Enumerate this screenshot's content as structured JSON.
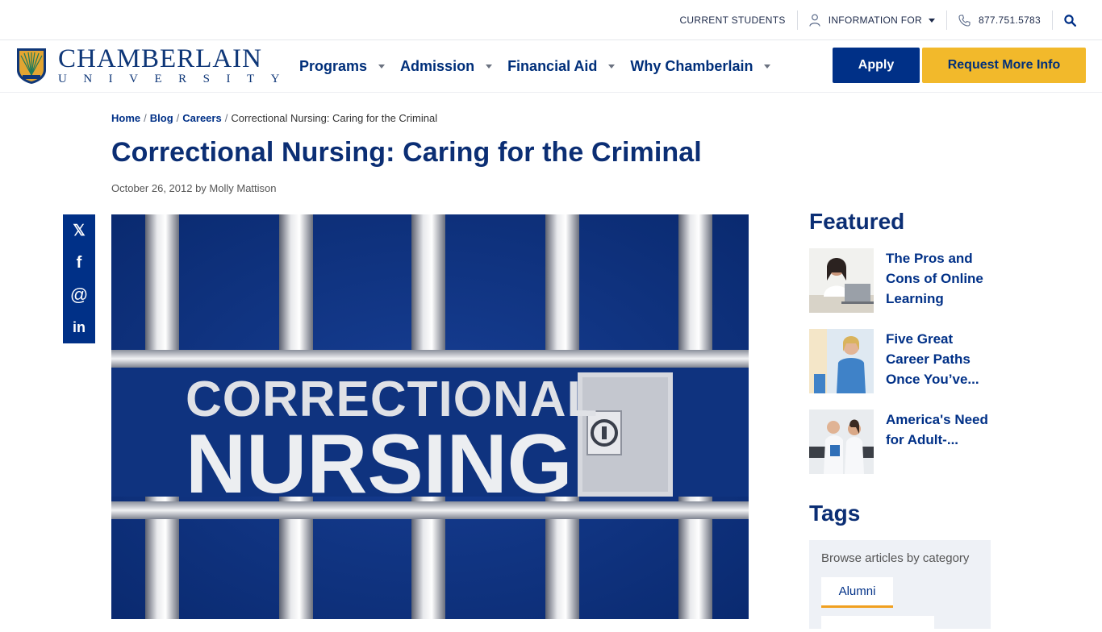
{
  "utility": {
    "current_students": "CURRENT STUDENTS",
    "information_for": "INFORMATION FOR",
    "phone": "877.751.5783"
  },
  "logo": {
    "name": "CHAMBERLAIN",
    "sub": "UNIVERSITY"
  },
  "nav": {
    "items": [
      {
        "label": "Programs"
      },
      {
        "label": "Admission"
      },
      {
        "label": "Financial Aid"
      },
      {
        "label": "Why Chamberlain"
      }
    ]
  },
  "cta": {
    "apply": "Apply",
    "request_info": "Request More Info"
  },
  "breadcrumb": {
    "home": "Home",
    "blog": "Blog",
    "careers": "Careers",
    "sep": "/",
    "current": "Correctional Nursing: Caring for the Criminal"
  },
  "article": {
    "title": "Correctional Nursing: Caring for the Criminal",
    "meta": "October 26, 2012 by Molly Mattison",
    "hero_text_line1": "CORRECTIONAL",
    "hero_text_line2": "NURSING"
  },
  "share": {
    "x_glyph": "𝕏",
    "facebook_glyph": "f",
    "email_glyph": "@",
    "linkedin_glyph": "in"
  },
  "sidebar": {
    "featured_heading": "Featured",
    "featured": [
      {
        "title": "The Pros and Cons of Online Learning"
      },
      {
        "title": "Five Great Career Paths Once You’ve..."
      },
      {
        "title": "America's Need for Adult-..."
      }
    ],
    "tags_heading": "Tags",
    "tags_caption": "Browse articles by category",
    "tags": [
      {
        "label": "Alumni"
      }
    ]
  },
  "colors": {
    "brand_blue": "#003087",
    "brand_gold": "#f2b92b"
  }
}
